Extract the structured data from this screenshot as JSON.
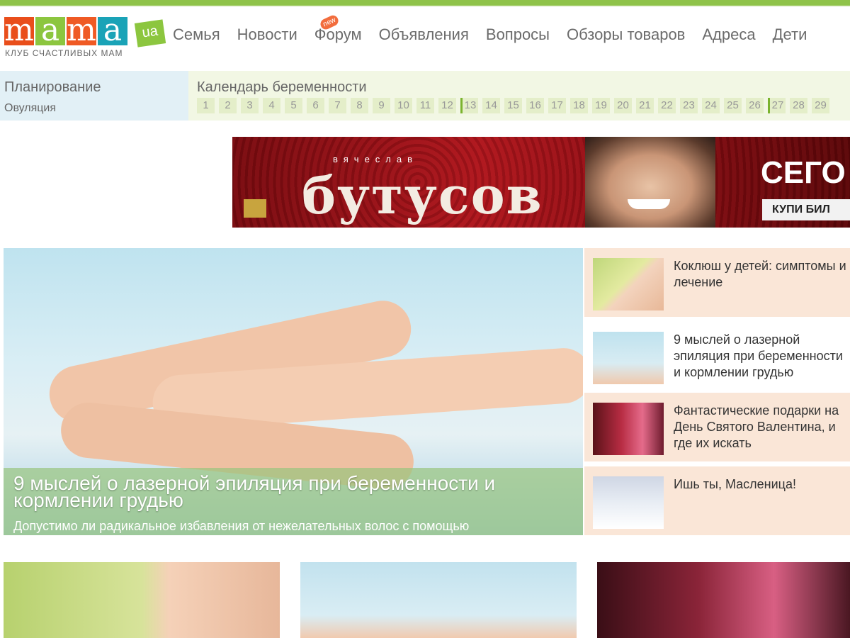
{
  "logo": {
    "letters": [
      "m",
      "a",
      "m",
      "a"
    ],
    "suffix": "ua",
    "tagline": "КЛУБ СЧАСТЛИВЫХ МАМ"
  },
  "nav": {
    "items": [
      "Семья",
      "Новости",
      "Форум",
      "Объявления",
      "Вопросы",
      "Обзоры товаров",
      "Адреса",
      "Дети"
    ],
    "new_badge": "new"
  },
  "planning": {
    "title": "Планирование",
    "sub": "Овуляция"
  },
  "calendar": {
    "title": "Календарь беременности",
    "weeks": [
      "1",
      "2",
      "3",
      "4",
      "5",
      "6",
      "7",
      "8",
      "9",
      "10",
      "11",
      "12",
      "13",
      "14",
      "15",
      "16",
      "17",
      "18",
      "19",
      "20",
      "21",
      "22",
      "23",
      "24",
      "25",
      "26",
      "27",
      "28",
      "29"
    ]
  },
  "banner": {
    "small": "вячеслав",
    "name": "бутусов",
    "cta": "СЕГО",
    "button": "КУПИ БИЛ"
  },
  "featured": {
    "title": "9 мыслей о лазерной эпиляция при беременности и кормлении грудью",
    "excerpt": "Допустимо ли радикальное избавления от нежелательных волос с помощью"
  },
  "articles": [
    {
      "title": "Коклюш у детей: симптомы и лечение",
      "icon": "child-photo"
    },
    {
      "title": "9 мыслей о лазерной эпиляция при беременности и кормлении грудью",
      "icon": "legs-photo"
    },
    {
      "title": "Фантастические подарки на День Святого Валентина, и где их искать",
      "icon": "couple-photo"
    },
    {
      "title": "Ишь ты, Масленица!",
      "icon": "sled-photo"
    }
  ],
  "colors": {
    "accent": "#8fc34a",
    "orange": "#e94e1b",
    "teal": "#1aa3b7",
    "sidebar_bg": "#fae6d7"
  }
}
